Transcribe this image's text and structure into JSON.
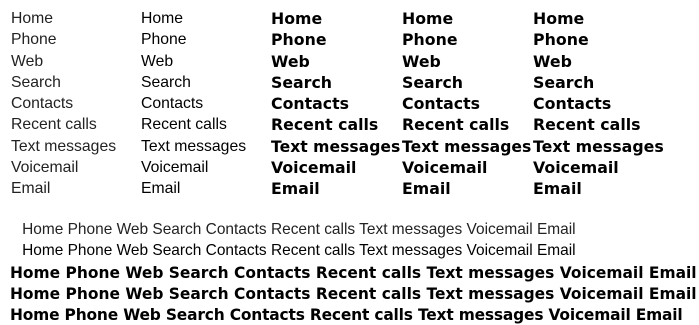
{
  "columns": [
    {
      "weight": "light",
      "items": [
        "Home",
        "Phone",
        "Web",
        "Search",
        "Contacts",
        "Recent calls",
        "Text messages",
        "Voicemail",
        "Email"
      ]
    },
    {
      "weight": "regular",
      "items": [
        "Home",
        "Phone",
        "Web",
        "Search",
        "Contacts",
        "Recent calls",
        "Text messages",
        "Voicemail",
        "Email"
      ]
    },
    {
      "weight": "semibold",
      "items": [
        "Home",
        "Phone",
        "Web",
        "Search",
        "Contacts",
        "Recent calls",
        "Text messages",
        "Voicemail",
        "Email"
      ]
    },
    {
      "weight": "bold",
      "items": [
        "Home",
        "Phone",
        "Web",
        "Search",
        "Contacts",
        "Recent calls",
        "Text messages",
        "Voicemail",
        "Email"
      ]
    },
    {
      "weight": "extrabold",
      "items": [
        "Home",
        "Phone",
        "Web",
        "Search",
        "Contacts",
        "Recent calls",
        "Text messages",
        "Voicemail",
        "Email"
      ]
    }
  ],
  "lines": [
    {
      "weight": "light",
      "text": "Home Phone Web Search Contacts Recent calls Text messages Voicemail Email"
    },
    {
      "weight": "regular",
      "text": "Home Phone Web Search Contacts Recent calls Text messages Voicemail Email"
    },
    {
      "weight": "semibold",
      "text": "Home Phone Web Search Contacts Recent calls Text messages Voicemail Email"
    },
    {
      "weight": "bold",
      "text": "Home Phone Web Search Contacts Recent calls Text messages Voicemail Email"
    },
    {
      "weight": "extrabold",
      "text": "Home Phone Web Search Contacts Recent calls Text messages Voicemail Email"
    }
  ]
}
